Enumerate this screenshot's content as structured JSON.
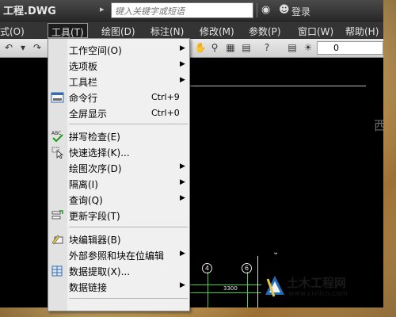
{
  "titlebar": {
    "title": "工程.DWG",
    "search_placeholder": "键入关键字或短语",
    "login_label": "登录"
  },
  "menubar": {
    "items": [
      "式(O)",
      "工具(T)",
      "绘图(D)",
      "标注(N)",
      "修改(M)",
      "参数(P)",
      "窗口(W)",
      "帮助(H)"
    ]
  },
  "toolbar": {
    "field_value": "0"
  },
  "tools_menu": {
    "items": [
      {
        "label": "工作空间(O)",
        "shortcut": "",
        "submenu": true
      },
      {
        "label": "选项板",
        "shortcut": "",
        "submenu": true
      },
      {
        "label": "工具栏",
        "shortcut": "",
        "submenu": true
      },
      {
        "label": "命令行",
        "shortcut": "Ctrl+9",
        "submenu": false
      },
      {
        "label": "全屏显示",
        "shortcut": "Ctrl+0",
        "submenu": false
      },
      {
        "label": "拼写检查(E)",
        "shortcut": "",
        "submenu": false
      },
      {
        "label": "快速选择(K)...",
        "shortcut": "",
        "submenu": false
      },
      {
        "label": "绘图次序(D)",
        "shortcut": "",
        "submenu": true
      },
      {
        "label": "隔离(I)",
        "shortcut": "",
        "submenu": true
      },
      {
        "label": "查询(Q)",
        "shortcut": "",
        "submenu": true
      },
      {
        "label": "更新字段(T)",
        "shortcut": "",
        "submenu": false
      },
      {
        "label": "块编辑器(B)",
        "shortcut": "",
        "submenu": false
      },
      {
        "label": "外部参照和块在位编辑",
        "shortcut": "",
        "submenu": true
      },
      {
        "label": "数据提取(X)...",
        "shortcut": "",
        "submenu": false
      },
      {
        "label": "数据链接",
        "shortcut": "",
        "submenu": true
      }
    ]
  },
  "drawing": {
    "side_char": "西",
    "bubble_4": "4",
    "bubble_6": "6",
    "dim_value": "3300"
  },
  "watermark": {
    "name": "土木工程网",
    "url": "www.civilcn.com"
  }
}
